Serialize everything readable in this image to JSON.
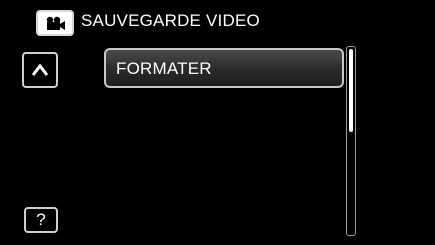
{
  "header": {
    "mode_icon": "video-camera-icon",
    "title": "SAUVEGARDE VIDEO"
  },
  "navigation": {
    "up_icon": "chevron-up-icon",
    "help_label": "?"
  },
  "menu": {
    "items": [
      {
        "label": "FORMATER"
      }
    ]
  },
  "scrollbar": {
    "position_fraction": 0.0,
    "visible_fraction": 0.45
  },
  "colors": {
    "background": "#000000",
    "text": "#ffffff",
    "border": "#c8c8c8"
  }
}
